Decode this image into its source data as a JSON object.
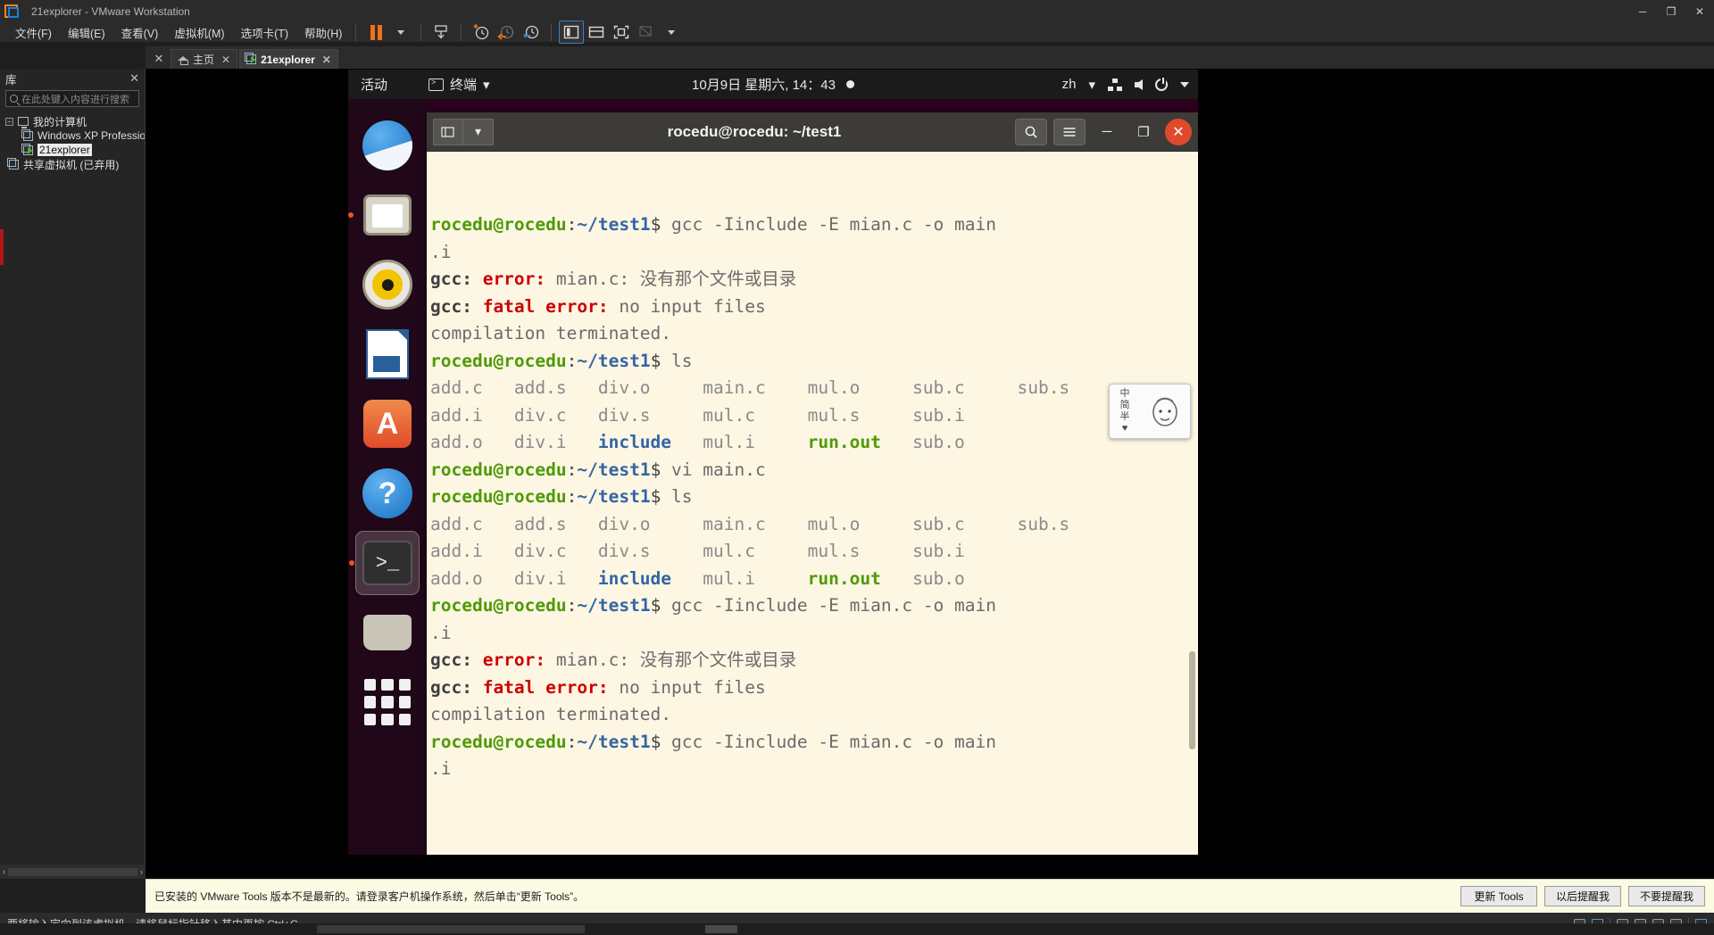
{
  "window": {
    "title": "21explorer - VMware Workstation",
    "minimize": "─",
    "maximize": "❐",
    "close": "✕"
  },
  "menubar": {
    "items": [
      {
        "label": "文件(F)"
      },
      {
        "label": "编辑(E)"
      },
      {
        "label": "查看(V)"
      },
      {
        "label": "虚拟机(M)"
      },
      {
        "label": "选项卡(T)"
      },
      {
        "label": "帮助(H)"
      }
    ]
  },
  "toolbar": {
    "pause": "pause-icon",
    "dropdown": "chevron-down-icon",
    "send_ctrl_alt_del": "send-key-icon",
    "snapshot_take": "snapshot-take-icon",
    "snapshot_revert": "snapshot-revert-icon",
    "snapshot_manager": "snapshot-manager-icon",
    "show_library": "show-library-icon",
    "show_thumbnails": "show-thumbnails-icon",
    "fullscreen": "fullscreen-icon",
    "unity": "unity-icon",
    "more": "chevron-down-icon"
  },
  "library": {
    "title": "库",
    "close": "✕",
    "search": {
      "placeholder": "在此处键入内容进行搜索",
      "value": ""
    },
    "tree": [
      {
        "label": "我的计算机",
        "level": 0,
        "expander": "−",
        "icon": "computer-icon",
        "selected": false,
        "running": false
      },
      {
        "label": "Windows XP Professio",
        "level": 1,
        "expander": "",
        "icon": "vm-icon",
        "selected": false,
        "running": false
      },
      {
        "label": "21explorer",
        "level": 1,
        "expander": "",
        "icon": "vm-icon",
        "selected": true,
        "running": true
      },
      {
        "label": "共享虚拟机 (已弃用)",
        "level": 0,
        "expander": "",
        "icon": "shared-vm-icon",
        "selected": false,
        "running": false
      }
    ],
    "scroll_left": "‹",
    "scroll_right": "›"
  },
  "tabs": {
    "close_all": "✕",
    "items": [
      {
        "label": "主页",
        "icon": "home-icon",
        "active": false,
        "close": "✕"
      },
      {
        "label": "21explorer",
        "icon": "vm-icon",
        "active": true,
        "close": "✕"
      }
    ]
  },
  "guest": {
    "topbar": {
      "activities": "活动",
      "app_name": "终端",
      "app_icon": "terminal-icon",
      "app_caret": "▾",
      "clock": "10月9日 星期六, 14：43",
      "record_dot": "record-indicator-icon",
      "language": "zh",
      "language_caret": "▾",
      "network_icon": "network-icon",
      "volume_icon": "volume-icon",
      "power_icon": "power-icon",
      "menu_caret": "▾"
    },
    "dock": [
      {
        "name": "thunderbird",
        "running": false
      },
      {
        "name": "files",
        "running": true
      },
      {
        "name": "rhythmbox",
        "running": false
      },
      {
        "name": "libreoffice-writer",
        "running": false
      },
      {
        "name": "ubuntu-software",
        "running": false
      },
      {
        "name": "help",
        "running": false
      },
      {
        "name": "terminal",
        "running": true
      },
      {
        "name": "trash",
        "running": false
      },
      {
        "name": "show-applications",
        "running": false
      }
    ],
    "terminal": {
      "title": "rocedu@rocedu: ~/test1",
      "new_tab": "+",
      "tab_dropdown": "▾",
      "search": "search-icon",
      "menu": "hamburger-icon",
      "minimize": "─",
      "maximize": "❐",
      "close": "✕",
      "prompt_user": "rocedu@rocedu",
      "prompt_colon": ":",
      "prompt_path": "~/test1",
      "prompt_dollar": "$ ",
      "lines": [
        {
          "type": "prompt",
          "cmd": "gcc -Iinclude -E mian.c -o main"
        },
        {
          "type": "cont",
          "text": ".i"
        },
        {
          "type": "gccerr",
          "head": "gcc: ",
          "err": "error: ",
          "rest": "mian.c: 没有那个文件或目录"
        },
        {
          "type": "gccerr",
          "head": "gcc: ",
          "err": "fatal error: ",
          "rest": "no input files"
        },
        {
          "type": "plain",
          "text": "compilation terminated."
        },
        {
          "type": "prompt",
          "cmd": "ls"
        },
        {
          "type": "ls",
          "cells": [
            {
              "t": "add.c",
              "c": "file"
            },
            {
              "t": "add.s",
              "c": "file"
            },
            {
              "t": "div.o",
              "c": "file"
            },
            {
              "t": "main.c",
              "c": "file"
            },
            {
              "t": "mul.o",
              "c": "file"
            },
            {
              "t": "sub.c",
              "c": "file"
            },
            {
              "t": "sub.s",
              "c": "file"
            }
          ]
        },
        {
          "type": "ls",
          "cells": [
            {
              "t": "add.i",
              "c": "file"
            },
            {
              "t": "div.c",
              "c": "file"
            },
            {
              "t": "div.s",
              "c": "file"
            },
            {
              "t": "mul.c",
              "c": "file"
            },
            {
              "t": "mul.s",
              "c": "file"
            },
            {
              "t": "sub.i",
              "c": "file"
            }
          ]
        },
        {
          "type": "ls",
          "cells": [
            {
              "t": "add.o",
              "c": "file"
            },
            {
              "t": "div.i",
              "c": "file"
            },
            {
              "t": "include",
              "c": "dir"
            },
            {
              "t": "mul.i",
              "c": "file"
            },
            {
              "t": "run.out",
              "c": "exe"
            },
            {
              "t": "sub.o",
              "c": "file"
            }
          ]
        },
        {
          "type": "prompt",
          "cmd": "vi main.c"
        },
        {
          "type": "prompt",
          "cmd": "ls"
        },
        {
          "type": "ls",
          "cells": [
            {
              "t": "add.c",
              "c": "file"
            },
            {
              "t": "add.s",
              "c": "file"
            },
            {
              "t": "div.o",
              "c": "file"
            },
            {
              "t": "main.c",
              "c": "file"
            },
            {
              "t": "mul.o",
              "c": "file"
            },
            {
              "t": "sub.c",
              "c": "file"
            },
            {
              "t": "sub.s",
              "c": "file"
            }
          ]
        },
        {
          "type": "ls",
          "cells": [
            {
              "t": "add.i",
              "c": "file"
            },
            {
              "t": "div.c",
              "c": "file"
            },
            {
              "t": "div.s",
              "c": "file"
            },
            {
              "t": "mul.c",
              "c": "file"
            },
            {
              "t": "mul.s",
              "c": "file"
            },
            {
              "t": "sub.i",
              "c": "file"
            }
          ]
        },
        {
          "type": "ls",
          "cells": [
            {
              "t": "add.o",
              "c": "file"
            },
            {
              "t": "div.i",
              "c": "file"
            },
            {
              "t": "include",
              "c": "dir"
            },
            {
              "t": "mul.i",
              "c": "file"
            },
            {
              "t": "run.out",
              "c": "exe"
            },
            {
              "t": "sub.o",
              "c": "file"
            }
          ]
        },
        {
          "type": "prompt",
          "cmd": "gcc -Iinclude -E mian.c -o main"
        },
        {
          "type": "cont",
          "text": ".i"
        },
        {
          "type": "gccerr",
          "head": "gcc: ",
          "err": "error: ",
          "rest": "mian.c: 没有那个文件或目录"
        },
        {
          "type": "gccerr",
          "head": "gcc: ",
          "err": "fatal error: ",
          "rest": "no input files"
        },
        {
          "type": "plain",
          "text": "compilation terminated."
        },
        {
          "type": "prompt",
          "cmd": "gcc -Iinclude -E mian.c -o main"
        },
        {
          "type": "cont",
          "text": ".i"
        }
      ]
    }
  },
  "ime": {
    "line1": "中",
    "line2": "简",
    "line3": "半",
    "line4": "♥",
    "face": "face-icon"
  },
  "notify": {
    "message": "已安装的 VMware Tools 版本不是最新的。请登录客户机操作系统，然后单击“更新 Tools”。",
    "buttons": [
      "更新 Tools",
      "以后提醒我",
      "不要提醒我"
    ]
  },
  "statusbar": {
    "text": "要将输入定向到该虚拟机，请将鼠标指针移入其中再按 Ctrl+G。"
  },
  "colors": {
    "accent_orange": "#f0701a",
    "accent_blue": "#2f7fd0",
    "terminal_bg": "#fdf6e3",
    "error_red": "#cc0000",
    "prompt_green": "#4e9a06",
    "path_blue": "#3465a4",
    "notify_bg": "#fbfbe4",
    "ubuntu_purple": "#2c001e"
  }
}
